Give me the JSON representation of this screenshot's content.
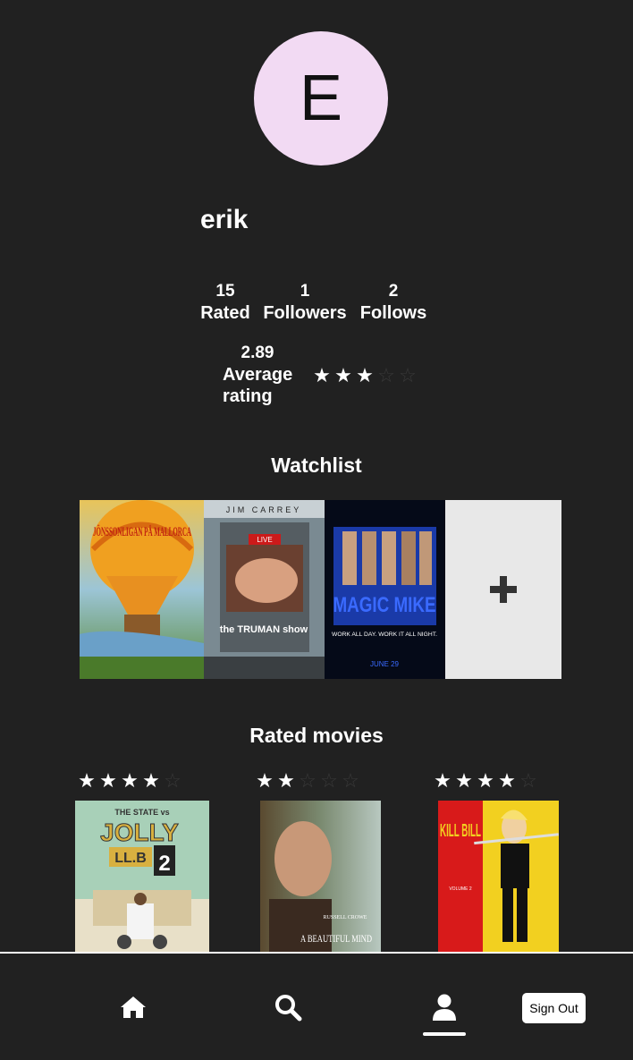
{
  "profile": {
    "avatar_letter": "E",
    "avatar_color": "#f2daf3",
    "username": "erik"
  },
  "stats": {
    "rated_count": "15",
    "rated_label": "Rated",
    "followers_count": "1",
    "followers_label": "Followers",
    "follows_count": "2",
    "follows_label": "Follows",
    "average_value": "2.89",
    "average_label_line1": "Average",
    "average_label_line2": "rating",
    "average_stars_filled": 3,
    "average_stars_total": 5
  },
  "watchlist": {
    "title": "Watchlist",
    "movies": [
      {
        "poster_text": "JÖNSSONLIGAN PÅ MALLORCA"
      },
      {
        "poster_text_top": "JIM CARREY",
        "poster_text_bottom": "the TRUMAN show",
        "poster_badge": "LIVE"
      },
      {
        "poster_text": "MAGIC MIKE",
        "poster_tagline": "WORK ALL DAY. WORK IT ALL NIGHT.",
        "poster_date": "JUNE 29"
      }
    ],
    "add_icon": "plus-icon"
  },
  "rated": {
    "title": "Rated movies",
    "movies": [
      {
        "stars": 4,
        "poster_title_top": "THE STATE vs",
        "poster_title_main": "JOLLY",
        "poster_title_sub": "LL.B",
        "poster_number": "2"
      },
      {
        "stars": 2,
        "poster_actor": "RUSSELL CROWE",
        "poster_title_main": "A BEAUTIFUL MIND"
      },
      {
        "stars": 4,
        "poster_title_main": "KILL BILL",
        "poster_sub": "VOLUME 2"
      }
    ]
  },
  "nav": {
    "home_icon": "home-icon",
    "search_icon": "search-icon",
    "profile_icon": "user-icon",
    "signout_label": "Sign Out",
    "active": "profile"
  }
}
